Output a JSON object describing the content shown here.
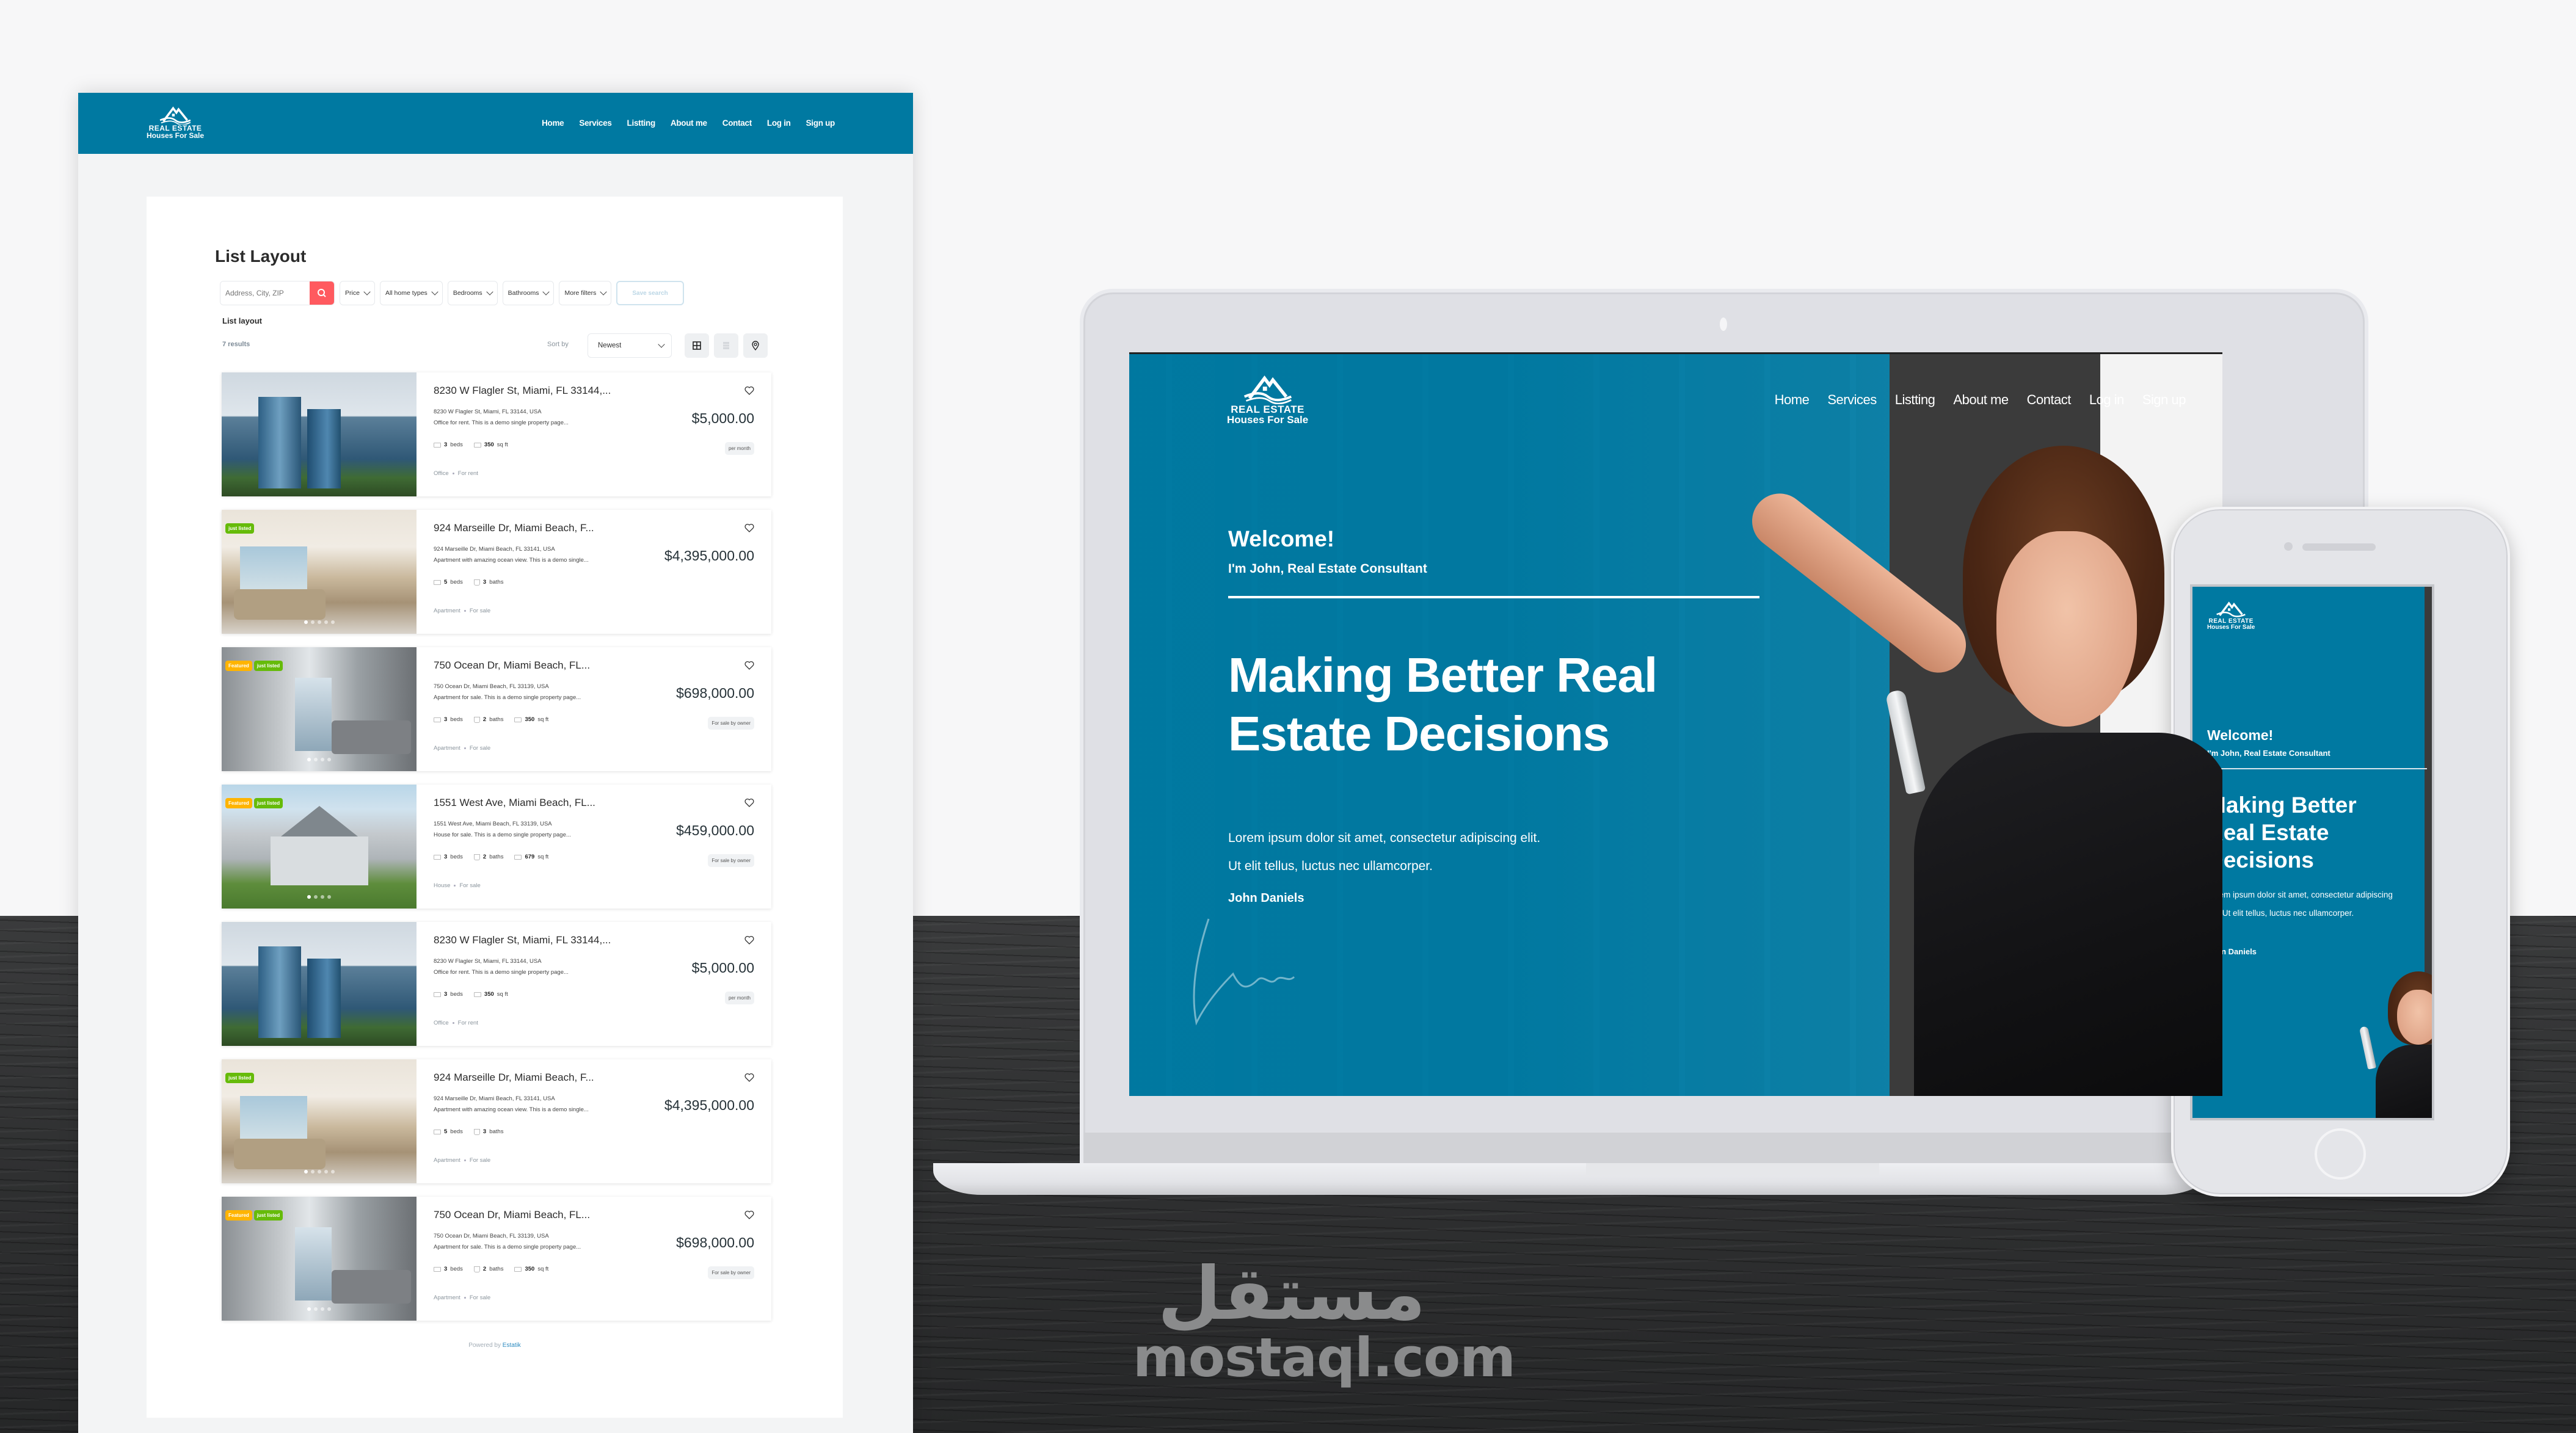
{
  "brand": {
    "logo_line1": "REAL ESTATE",
    "logo_line2": "Houses For Sale",
    "primary_color": "#0079a1",
    "accent_color": "#ff5a5f"
  },
  "nav": {
    "items": [
      "Home",
      "Services",
      "Listting",
      "About me",
      "Contact",
      "Log in",
      "Sign up"
    ]
  },
  "list_page": {
    "title": "List Layout",
    "search": {
      "placeholder": "Address, City, ZIP",
      "icon": "search-icon"
    },
    "filters": [
      "Price",
      "All home types",
      "Bedrooms",
      "Bathrooms",
      "More filters"
    ],
    "save_search_label": "Save search",
    "subtitle": "List layout",
    "results_count": "7 results",
    "sort": {
      "label": "Sort by",
      "value": "Newest"
    },
    "view_buttons": [
      "grid-view-icon",
      "list-view-icon",
      "map-pin-icon"
    ],
    "listings": [
      {
        "title": "8230 W Flagler St, Miami, FL 33144,...",
        "address": "8230 W Flagler St, Miami, FL 33144, USA",
        "description": "Office for rent. This is a demo single property page...",
        "beds": "3",
        "beds_label": "beds",
        "area": "350",
        "area_label": "sq ft",
        "price": "$5,000.00",
        "price_note": "per month",
        "type": "Office",
        "status": "For rent",
        "badges": [],
        "image": "office"
      },
      {
        "title": "924 Marseille Dr, Miami Beach, F...",
        "address": "924 Marseille Dr, Miami Beach, FL 33141, USA",
        "description": "Apartment with amazing ocean view. This is a demo single...",
        "beds": "5",
        "beds_label": "beds",
        "baths": "3",
        "baths_label": "baths",
        "price": "$4,395,000.00",
        "type": "Apartment",
        "status": "For sale",
        "badges": [
          "just listed"
        ],
        "image": "living"
      },
      {
        "title": "750 Ocean Dr, Miami Beach, FL...",
        "address": "750 Ocean Dr, Miami Beach, FL 33139, USA",
        "description": "Apartment for sale. This is a demo single property page...",
        "beds": "3",
        "beds_label": "beds",
        "baths": "2",
        "baths_label": "baths",
        "area": "350",
        "area_label": "sq ft",
        "price": "$698,000.00",
        "price_note": "For sale by owner",
        "type": "Apartment",
        "status": "For sale",
        "badges": [
          "Featured",
          "just listed"
        ],
        "image": "condo"
      },
      {
        "title": "1551 West Ave, Miami Beach, FL...",
        "address": "1551 West Ave, Miami Beach, FL 33139, USA",
        "description": "House for sale. This is a demo single property page...",
        "beds": "3",
        "beds_label": "beds",
        "baths": "2",
        "baths_label": "baths",
        "area": "679",
        "area_label": "sq ft",
        "price": "$459,000.00",
        "price_note": "For sale by owner",
        "type": "House",
        "status": "For sale",
        "badges": [
          "Featured",
          "just listed"
        ],
        "image": "house"
      },
      {
        "title": "8230 W Flagler St, Miami, FL 33144,...",
        "address": "8230 W Flagler St, Miami, FL 33144, USA",
        "description": "Office for rent. This is a demo single property page...",
        "beds": "3",
        "beds_label": "beds",
        "area": "350",
        "area_label": "sq ft",
        "price": "$5,000.00",
        "price_note": "per month",
        "type": "Office",
        "status": "For rent",
        "badges": [],
        "image": "office"
      },
      {
        "title": "924 Marseille Dr, Miami Beach, F...",
        "address": "924 Marseille Dr, Miami Beach, FL 33141, USA",
        "description": "Apartment with amazing ocean view. This is a demo single...",
        "beds": "5",
        "beds_label": "beds",
        "baths": "3",
        "baths_label": "baths",
        "price": "$4,395,000.00",
        "type": "Apartment",
        "status": "For sale",
        "badges": [
          "just listed"
        ],
        "image": "living"
      },
      {
        "title": "750 Ocean Dr, Miami Beach, FL...",
        "address": "750 Ocean Dr, Miami Beach, FL 33139, USA",
        "description": "Apartment for sale. This is a demo single property page...",
        "beds": "3",
        "beds_label": "beds",
        "baths": "2",
        "baths_label": "baths",
        "area": "350",
        "area_label": "sq ft",
        "price": "$698,000.00",
        "price_note": "For sale by owner",
        "type": "Apartment",
        "status": "For sale",
        "badges": [
          "Featured",
          "just listed"
        ],
        "image": "condo"
      }
    ],
    "powered_by": "Powered by",
    "powered_by_brand": "Estatik"
  },
  "hero": {
    "welcome": "Welcome!",
    "subtitle": "I'm John, Real Estate Consultant",
    "headline": "Making Better Real Estate Decisions",
    "lorem_line1": "Lorem ipsum dolor sit amet, consectetur adipiscing elit.",
    "lorem_line2": "Ut elit tellus, luctus nec ullamcorper.",
    "author": "John Daniels"
  },
  "phone_hero": {
    "welcome": "Welcome!",
    "subtitle": "I'm John, Real Estate Consultant",
    "headline": "Making Better Real Estate Decisions",
    "lorem": "Lorem ipsum dolor sit amet, consectetur adipiscing elit. Ut elit tellus, luctus nec ullamcorper.",
    "author": "John Daniels"
  },
  "watermark": {
    "arabic": "مستقل",
    "latin": "mostaql.com"
  }
}
